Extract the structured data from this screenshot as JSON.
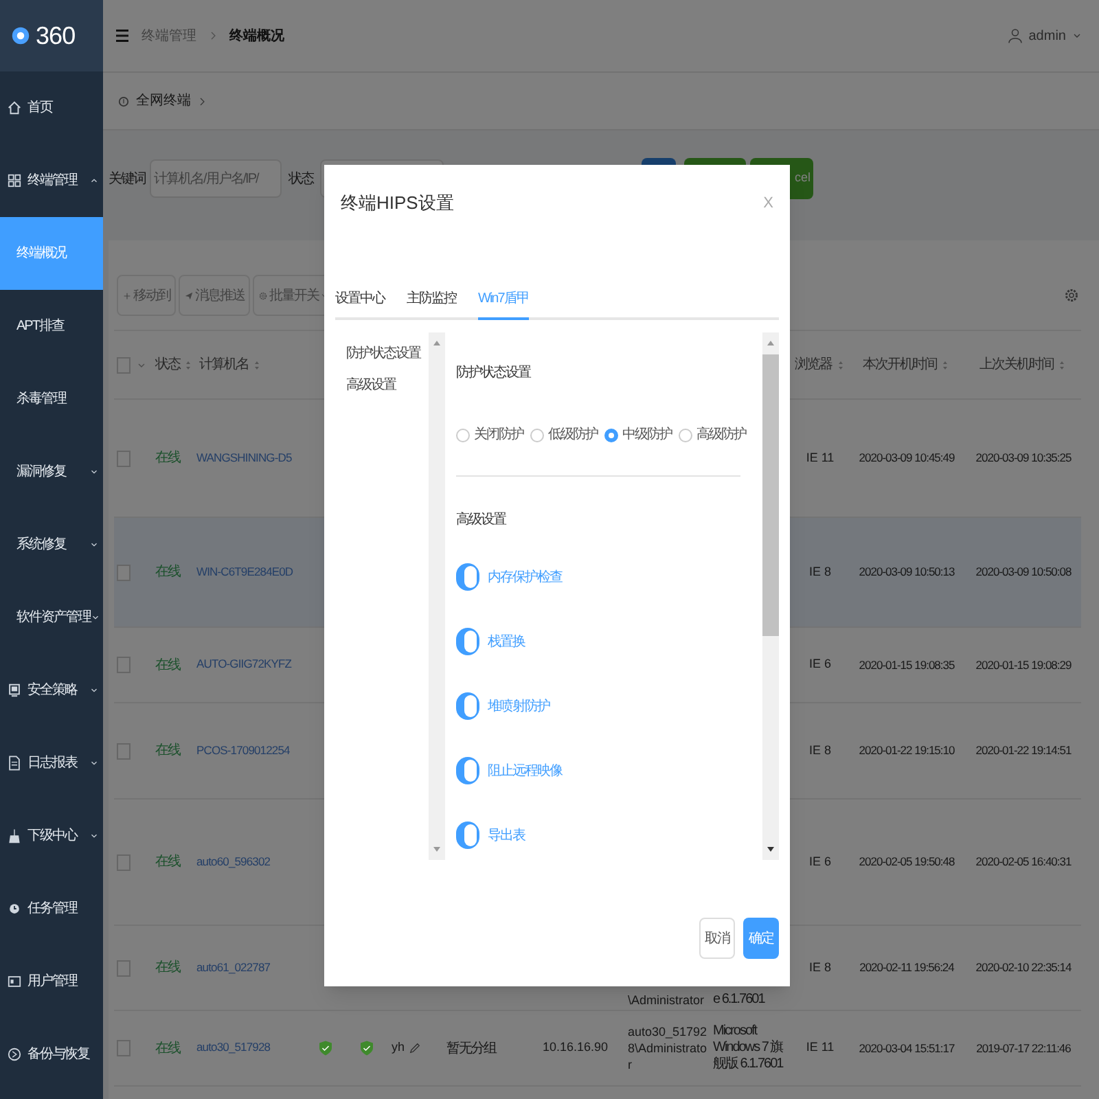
{
  "sidebar": {
    "logo": "360",
    "items": [
      {
        "label": "首页",
        "selected": false
      },
      {
        "label": "终端管理",
        "selected": false,
        "expanded": true,
        "children": [
          {
            "label": "终端概况",
            "selected": true
          },
          {
            "label": "APT排查",
            "selected": false
          },
          {
            "label": "杀毒管理",
            "selected": false
          },
          {
            "label": "漏洞修复",
            "selected": false,
            "expanded": false
          },
          {
            "label": "系统修复",
            "selected": false,
            "expanded": false
          },
          {
            "label": "软件资产管理",
            "selected": false,
            "expanded": false
          }
        ]
      },
      {
        "label": "安全策略",
        "selected": false,
        "expanded": false
      },
      {
        "label": "日志报表",
        "selected": false,
        "expanded": false
      },
      {
        "label": "下级中心",
        "selected": false,
        "expanded": false
      },
      {
        "label": "任务管理",
        "selected": false
      },
      {
        "label": "用户管理",
        "selected": false
      },
      {
        "label": "备份与恢复",
        "selected": false
      }
    ]
  },
  "header": {
    "breadcrumb": [
      "终端管理",
      "终端概况"
    ],
    "user": "admin"
  },
  "scope": {
    "label": "全网终端"
  },
  "filters": {
    "keyword_label": "关键词",
    "keyword_placeholder": "计算机名/用户名/IP/",
    "status_label": "状态",
    "export_button": "cel"
  },
  "toolbar": {
    "buttons": [
      "移动到",
      "消息推送",
      "批量开关"
    ]
  },
  "table": {
    "all_checked": false,
    "columns": [
      "状态",
      "计算机名",
      "浏览器",
      "本次开机时间",
      "上次关机时间"
    ],
    "rows": [
      {
        "selected": false,
        "checked": false,
        "status": "在线",
        "name": "WANGSHINING-D5",
        "browser": "IE 11",
        "boot": "2020-03-09 10:45:49",
        "shutdown": "2020-03-09 10:35:25"
      },
      {
        "selected": true,
        "checked": false,
        "status": "在线",
        "name": "WIN-C6T9E284E0D",
        "browser": "IE 8",
        "boot": "2020-03-09 10:50:13",
        "shutdown": "2020-03-09 10:50:08"
      },
      {
        "selected": false,
        "checked": false,
        "status": "在线",
        "name": "AUTO-GIIG72KYFZ",
        "browser": "IE 6",
        "boot": "2020-01-15 19:08:35",
        "shutdown": "2020-01-15 19:08:29"
      },
      {
        "selected": false,
        "checked": false,
        "status": "在线",
        "name": "PCOS-1709012254",
        "browser": "IE 8",
        "boot": "2020-01-22 19:15:10",
        "shutdown": "2020-01-22 19:14:51"
      },
      {
        "selected": false,
        "checked": false,
        "status": "在线",
        "name": "auto60_596302",
        "browser": "IE 6",
        "boot": "2020-02-05 19:50:48",
        "shutdown": "2020-02-05 16:40:31"
      },
      {
        "selected": false,
        "checked": false,
        "status": "在线",
        "name": "auto61_022787",
        "user": "\\Administrator",
        "os": "e 6.1.7601",
        "browser": "IE 8",
        "boot": "2020-02-11 19:56:24",
        "shutdown": "2020-02-10 22:35:14"
      },
      {
        "selected": false,
        "checked": false,
        "status": "在线",
        "name": "auto30_517928",
        "shields": [
          {
            "color": "#3f8a2c"
          },
          {
            "color": "#3f8a2c"
          }
        ],
        "note": "yh",
        "group": "暂无分组",
        "ip": "10.16.16.90",
        "user": "auto30_517928\\Administrator",
        "os": "Microsoft Windows 7 旗舰版 6.1.7601",
        "browser": "IE 11",
        "boot": "2020-03-04 15:51:17",
        "shutdown": "2019-07-17 22:11:46"
      }
    ]
  },
  "dialog": {
    "title": "终端HIPS设置",
    "close": "X",
    "tabs": [
      {
        "label": "设置中心",
        "selected": false
      },
      {
        "label": "主防监控",
        "selected": false
      },
      {
        "label": "Win7盾甲",
        "selected": true
      }
    ],
    "nav": [
      "防护状态设置",
      "高级设置"
    ],
    "status_section": {
      "title": "防护状态设置",
      "options": [
        {
          "label": "关闭防护",
          "selected": false
        },
        {
          "label": "低级防护",
          "selected": false
        },
        {
          "label": "中级防护",
          "selected": true
        },
        {
          "label": "高级防护",
          "selected": false
        }
      ]
    },
    "advanced_section": {
      "title": "高级设置",
      "switches": [
        {
          "label": "内存保护检查",
          "on": true
        },
        {
          "label": "栈置换",
          "on": true
        },
        {
          "label": "堆喷射防护",
          "on": true
        },
        {
          "label": "阻止远程映像",
          "on": true
        },
        {
          "label": "导出表",
          "on": true
        }
      ]
    },
    "buttons": {
      "cancel": "取消",
      "ok": "确定"
    }
  }
}
